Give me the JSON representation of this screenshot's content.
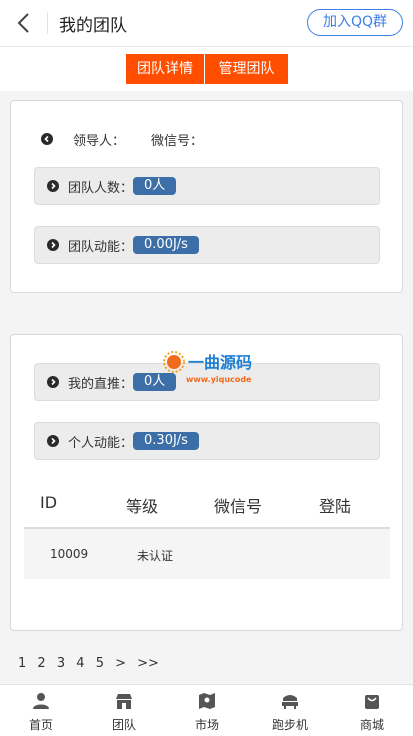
{
  "header": {
    "title": "我的团队",
    "join_button": "加入QQ群"
  },
  "tabs": [
    "团队详情",
    "管理团队"
  ],
  "team_card": {
    "leader_label": "领导人：",
    "wechat_label": "微信号：",
    "member_count_label": "团队人数：",
    "member_count_value": "0人",
    "team_power_label": "团队动能：",
    "team_power_value": "0.00J/s"
  },
  "personal_card": {
    "direct_label": "我的直推：",
    "direct_value": "0人",
    "personal_power_label": "个人动能：",
    "personal_power_value": "0.30J/s",
    "table": {
      "columns": [
        "ID",
        "等级",
        "微信号",
        "登陆"
      ],
      "rows": [
        {
          "id": "10009",
          "level": "未认证",
          "wechat": "",
          "login": ""
        }
      ]
    }
  },
  "watermark": {
    "brand": "一曲源码",
    "url": "www.yiqucode.com"
  },
  "pagination": [
    "1",
    "2",
    "3",
    "4",
    "5",
    ">",
    ">>"
  ],
  "bottom_nav": [
    {
      "label": "首页",
      "icon": "person-icon"
    },
    {
      "label": "团队",
      "icon": "store-icon"
    },
    {
      "label": "市场",
      "icon": "map-icon"
    },
    {
      "label": "跑步机",
      "icon": "treadmill-icon"
    },
    {
      "label": "商城",
      "icon": "shopping-bag-icon"
    }
  ]
}
